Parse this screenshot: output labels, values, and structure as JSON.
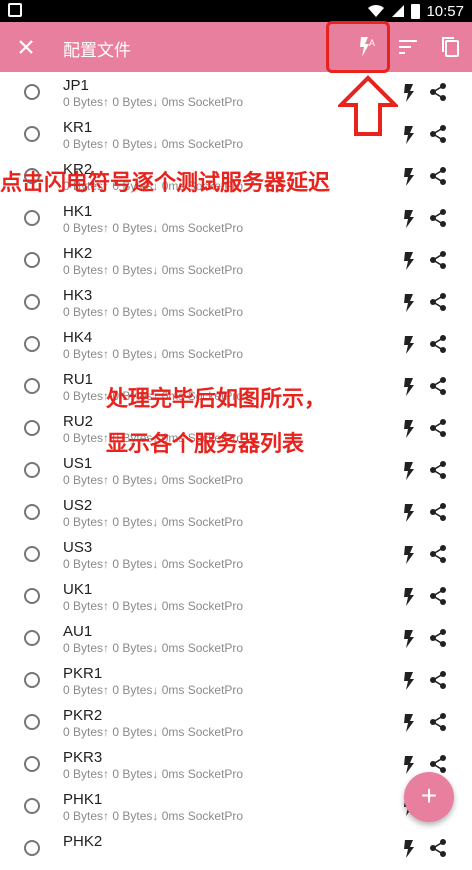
{
  "status_bar": {
    "time": "10:57"
  },
  "toolbar": {
    "title": "配置文件",
    "icons": [
      "close-icon",
      "test-latency-icon",
      "sort-icon",
      "copy-icon"
    ]
  },
  "annotations": {
    "line1": "点击闪电符号逐个测试服务器延迟",
    "line2": "处理完毕后如图所示，",
    "line3": "显示各个服务器列表"
  },
  "servers": [
    {
      "name": "JP1",
      "stats": "0 Bytes↑ 0 Bytes↓ 0ms SocketPro"
    },
    {
      "name": "KR1",
      "stats": "0 Bytes↑ 0 Bytes↓ 0ms SocketPro"
    },
    {
      "name": "KR2",
      "stats": "0 Bytes↑ 0 Bytes↓ 0ms SocketPro"
    },
    {
      "name": "HK1",
      "stats": "0 Bytes↑ 0 Bytes↓ 0ms SocketPro"
    },
    {
      "name": "HK2",
      "stats": "0 Bytes↑ 0 Bytes↓ 0ms SocketPro"
    },
    {
      "name": "HK3",
      "stats": "0 Bytes↑ 0 Bytes↓ 0ms SocketPro"
    },
    {
      "name": "HK4",
      "stats": "0 Bytes↑ 0 Bytes↓ 0ms SocketPro"
    },
    {
      "name": "RU1",
      "stats": "0 Bytes↑ 0 Bytes↓ 0ms SocketPro"
    },
    {
      "name": "RU2",
      "stats": "0 Bytes↑ 0 Bytes↓ 0ms SocketPro"
    },
    {
      "name": "US1",
      "stats": "0 Bytes↑ 0 Bytes↓ 0ms SocketPro"
    },
    {
      "name": "US2",
      "stats": "0 Bytes↑ 0 Bytes↓ 0ms SocketPro"
    },
    {
      "name": "US3",
      "stats": "0 Bytes↑ 0 Bytes↓ 0ms SocketPro"
    },
    {
      "name": "UK1",
      "stats": "0 Bytes↑ 0 Bytes↓ 0ms SocketPro"
    },
    {
      "name": "AU1",
      "stats": "0 Bytes↑ 0 Bytes↓ 0ms SocketPro"
    },
    {
      "name": "PKR1",
      "stats": "0 Bytes↑ 0 Bytes↓ 0ms SocketPro"
    },
    {
      "name": "PKR2",
      "stats": "0 Bytes↑ 0 Bytes↓ 0ms SocketPro"
    },
    {
      "name": "PKR3",
      "stats": "0 Bytes↑ 0 Bytes↓ 0ms SocketPro"
    },
    {
      "name": "PHK1",
      "stats": "0 Bytes↑ 0 Bytes↓ 0ms SocketPro"
    },
    {
      "name": "PHK2",
      "stats": ""
    }
  ],
  "fab": {
    "icon": "add-icon",
    "label": "+"
  },
  "colors": {
    "accent": "#e97f9f",
    "annotation": "#e8231e"
  }
}
